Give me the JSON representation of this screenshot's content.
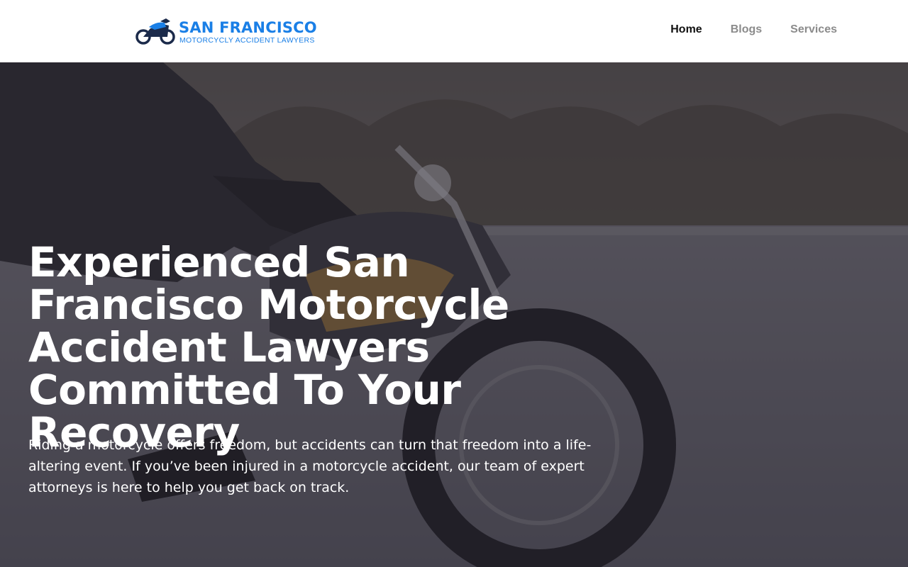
{
  "header": {
    "logo": {
      "title": "SAN FRANCISCO",
      "subtitle": "MOTORCYCLY ACCIDENT LAWYERS",
      "icon": "motorcycle-icon",
      "color": "#1a7fe6"
    },
    "nav": [
      {
        "label": "Home",
        "active": true
      },
      {
        "label": "Blogs",
        "active": false
      },
      {
        "label": "Services",
        "active": false
      }
    ]
  },
  "hero": {
    "title": "Experienced San Francisco Motorcycle Accident Lawyers Committed To Your Recovery",
    "text": "Riding a motorcycle offers freedom, but accidents can turn that freedom into a life-altering event. If you’ve been injured in a motorcycle accident, our team of expert attorneys is here to help you get back on track.",
    "background": "motorcycle-rider-photo"
  }
}
